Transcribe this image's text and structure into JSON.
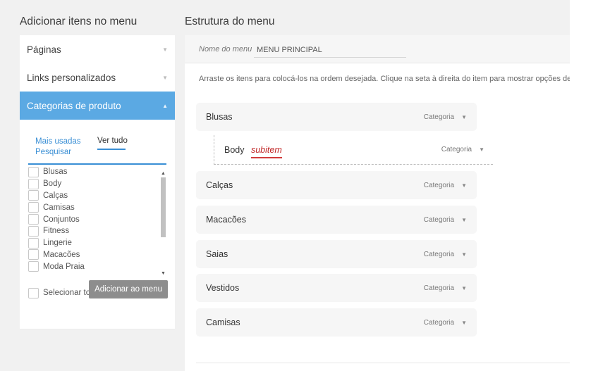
{
  "left": {
    "title": "Adicionar itens no menu",
    "accordions": [
      {
        "label": "Páginas"
      },
      {
        "label": "Links personalizados"
      },
      {
        "label": "Categorias de produto"
      }
    ],
    "tabs": {
      "most_used": "Mais usadas",
      "search": "Pesquisar",
      "view_all": "Ver tudo"
    },
    "checklist": [
      "Blusas",
      "Body",
      "Calças",
      "Camisas",
      "Conjuntos",
      "Fitness",
      "Lingerie",
      "Macacões",
      "Moda Praia"
    ],
    "select_all": "Selecionar todos",
    "add_button": "Adicionar ao menu"
  },
  "right": {
    "title": "Estrutura do menu",
    "menu_name_label": "Nome do menu",
    "menu_name_value": "MENU PRINCIPAL",
    "instructions": "Arraste os itens para colocá-los na ordem desejada. Clique na seta à direita do item para mostrar opções de configuração adicionais.",
    "items": [
      {
        "label": "Blusas",
        "type": "Categoria"
      },
      {
        "label": "Body",
        "sub_tag": "subitem",
        "type": "Categoria"
      },
      {
        "label": "Calças",
        "type": "Categoria"
      },
      {
        "label": "Macacões",
        "type": "Categoria"
      },
      {
        "label": "Saias",
        "type": "Categoria"
      },
      {
        "label": "Vestidos",
        "type": "Categoria"
      },
      {
        "label": "Camisas",
        "type": "Categoria"
      }
    ]
  },
  "icons": {
    "caret": "▼",
    "caret_up": "▲"
  },
  "colors": {
    "accent": "#5ba9e3",
    "link": "#3a8fd5",
    "subitem_mark": "#d23b3b",
    "button": "#8d8d8d"
  }
}
